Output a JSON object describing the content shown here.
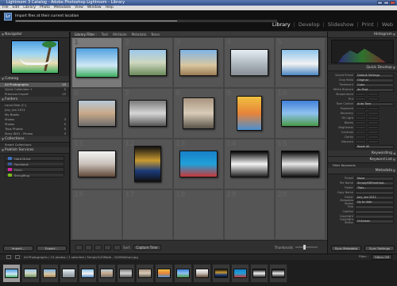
{
  "window": {
    "title": "Lightroom 3 Catalog - Adobe Photoshop Lightroom - Library",
    "menu": [
      "File",
      "Edit",
      "Library",
      "Photo",
      "Metadata",
      "View",
      "Window",
      "Help"
    ]
  },
  "identity": {
    "logo": "Lr",
    "import_message": "Import files at their current location",
    "progress": 0.62
  },
  "modules": [
    "Library",
    "Develop",
    "Slideshow",
    "Print",
    "Web"
  ],
  "left_panel": {
    "navigator": {
      "title": "Navigator",
      "zoom": [
        "FIT",
        "FILL",
        "1:1",
        "3:1"
      ]
    },
    "catalog": {
      "title": "Catalog",
      "items": [
        {
          "label": "All Photographs",
          "count": "15"
        },
        {
          "label": "Quick Collection +",
          "count": "0"
        },
        {
          "label": "Previous Import",
          "count": "15"
        }
      ]
    },
    "folders": {
      "title": "Folders",
      "items": [
        {
          "label": "Local Disk (C:)",
          "count": ""
        },
        {
          "label": "July, Jan 2011",
          "count": ""
        },
        {
          "label": "My Books",
          "count": ""
        },
        {
          "label": "Shows",
          "count": "3"
        },
        {
          "label": "Shows",
          "count": "5"
        },
        {
          "label": "Trips Photos",
          "count": "5"
        },
        {
          "label": "Sony WX1 - Picasa",
          "count": "3"
        }
      ]
    },
    "collections": {
      "title": "Collections",
      "items": [
        {
          "label": "Smart Collections",
          "count": ""
        }
      ]
    },
    "publish": {
      "title": "Publish Services",
      "items": [
        {
          "label": "Hard Drive",
          "color": "#3a6fb8"
        },
        {
          "label": "Facebook",
          "color": "#3b5998"
        },
        {
          "label": "Flickr",
          "color": "#d6249f"
        },
        {
          "label": "SmugMug",
          "color": "#7ab51d"
        }
      ]
    },
    "buttons": {
      "import": "Import...",
      "export": "Export..."
    }
  },
  "center": {
    "filter_bar": [
      "Library Filter :",
      "Text",
      "Attribute",
      "Metadata",
      "None"
    ],
    "toolbar": {
      "sort_label": "Sort:",
      "sort_value": "Capture Time",
      "thumbnails_label": "Thumbnails"
    },
    "grid": [
      {
        "n": "1",
        "selected": true,
        "w": 54,
        "h": 38,
        "bg": "linear-gradient(#4fa0e0, #cfe8f5 60%, #3fae60)"
      },
      {
        "n": "2",
        "selected": false,
        "w": 48,
        "h": 34,
        "bg": "linear-gradient(#9cc7ea, #cfd8c0 50%, #6a8a5a)"
      },
      {
        "n": "3",
        "selected": false,
        "w": 48,
        "h": 34,
        "bg": "linear-gradient(#7fb3e5, #d9c7a0 60%, #9a7b55)"
      },
      {
        "n": "4",
        "selected": false,
        "w": 48,
        "h": 34,
        "bg": "linear-gradient(#e5eef5, #a0a8b0 70%, #8a8f96)"
      },
      {
        "n": "5",
        "selected": false,
        "w": 48,
        "h": 34,
        "bg": "linear-gradient(#8ec5ec, #f2f2f2 55%, #4b86c2)"
      },
      {
        "n": "6",
        "selected": false,
        "w": 48,
        "h": 34,
        "bg": "linear-gradient(#b6c9d7, #c9a889 50%, #6d6d6d)"
      },
      {
        "n": "7",
        "selected": false,
        "w": 48,
        "h": 34,
        "bg": "linear-gradient(#7a7a7a, #d6d6d6 50%, #555)"
      },
      {
        "n": "8",
        "selected": false,
        "w": 40,
        "h": 40,
        "bg": "linear-gradient(#a89480, #d8ccb8 50%, #5a5248)"
      },
      {
        "n": "9",
        "selected": false,
        "w": 32,
        "h": 44,
        "bg": "linear-gradient(#f0c040, #e8843a 50%, #4a90d0)"
      },
      {
        "n": "10",
        "selected": false,
        "w": 48,
        "h": 34,
        "bg": "linear-gradient(#3f7fd8, #8fc2f0 50%, #4a9a4a)"
      },
      {
        "n": "11",
        "selected": false,
        "w": 48,
        "h": 34,
        "bg": "linear-gradient(#f4f4f4, #c8c0b8 50%, #604838)"
      },
      {
        "n": "12",
        "selected": false,
        "w": 34,
        "h": 46,
        "bg": "linear-gradient(#111, #c99a30 40%, #1a3a7a 70%, #111)"
      },
      {
        "n": "13",
        "selected": false,
        "w": 48,
        "h": 34,
        "bg": "linear-gradient(#1880c8, #20a0d8 50%, #c83838)"
      },
      {
        "n": "14",
        "selected": false,
        "w": 48,
        "h": 34,
        "bg": "linear-gradient(#000, #f4f4f4 50%, #222)"
      },
      {
        "n": "15",
        "selected": false,
        "w": 48,
        "h": 34,
        "bg": "linear-gradient(#000, #e8e8e8 50%, #111)"
      },
      {
        "n": "16",
        "selected": false,
        "w": 0,
        "h": 0,
        "bg": ""
      },
      {
        "n": "17",
        "selected": false,
        "w": 0,
        "h": 0,
        "bg": ""
      },
      {
        "n": "18",
        "selected": false,
        "w": 0,
        "h": 0,
        "bg": ""
      },
      {
        "n": "19",
        "selected": false,
        "w": 0,
        "h": 0,
        "bg": ""
      },
      {
        "n": "20",
        "selected": false,
        "w": 0,
        "h": 0,
        "bg": ""
      }
    ]
  },
  "right_panel": {
    "histogram": {
      "title": "Histogram"
    },
    "quick_develop": {
      "title": "Quick Develop",
      "rows": [
        {
          "label": "Saved Preset",
          "value": "Default Settings"
        },
        {
          "label": "Crop Ratio",
          "value": "Original"
        },
        {
          "label": "Treatment",
          "value": "Color"
        }
      ],
      "white_balance": {
        "label": "White Balance",
        "value": "As Shot"
      },
      "wb_rows": [
        "Temperature",
        "Tint"
      ],
      "tone_control": {
        "label": "Tone Control",
        "value": "Auto Tone"
      },
      "tone_rows": [
        "Exposure",
        "Recovery",
        "Fill Light",
        "Blacks",
        "Brightness",
        "Contrast"
      ],
      "presence_rows": [
        "Clarity",
        "Vibrance"
      ],
      "reset": "Reset All"
    },
    "keywording": {
      "title": "Keywording"
    },
    "keyword_list": {
      "title": "Keyword List",
      "filter": "Filter Keywords"
    },
    "metadata": {
      "title": "Metadata",
      "preset_label": "Preset",
      "preset_value": "None",
      "rows": [
        {
          "label": "File Name",
          "value": "SimplyHDRmethod..."
        },
        {
          "label": "Folder",
          "value": "Trips..."
        },
        {
          "label": "Copy Name",
          "value": ""
        },
        {
          "label": "Folder",
          "value": "July, Jan 2011"
        },
        {
          "label": "Metadata Status",
          "value": "Up to date"
        },
        {
          "label": "Title",
          "value": ""
        },
        {
          "label": "Caption",
          "value": ""
        },
        {
          "label": "Copyright",
          "value": ""
        },
        {
          "label": "Copyright Status",
          "value": "Unknown"
        }
      ]
    },
    "buttons": {
      "sync_metadata": "Sync Metadata",
      "sync_settings": "Sync Settings"
    }
  },
  "filmstrip": {
    "path": "All Photographs / 15 photos / 1 selected / Simply%20Moth...%20Method.jpg",
    "filter_label": "Filter :",
    "filter_value": "Filters Off",
    "thumbs": [
      "linear-gradient(#4fa0e0,#cfe8f5 60%,#3fae60)",
      "linear-gradient(#9cc7ea,#cfd8c0 50%,#6a8a5a)",
      "linear-gradient(#7fb3e5,#d9c7a0 60%,#9a7b55)",
      "linear-gradient(#e5eef5,#a0a8b0 70%,#8a8f96)",
      "linear-gradient(#8ec5ec,#f2f2f2 55%,#4b86c2)",
      "linear-gradient(#b6c9d7,#c9a889 50%,#6d6d6d)",
      "linear-gradient(#7a7a7a,#d6d6d6 50%,#555)",
      "linear-gradient(#a89480,#d8ccb8 50%,#5a5248)",
      "linear-gradient(#f0c040,#e8843a 50%,#4a90d0)",
      "linear-gradient(#3f7fd8,#8fc2f0 50%,#4a9a4a)",
      "linear-gradient(#f4f4f4,#c8c0b8 50%,#604838)",
      "linear-gradient(#111,#c99a30 40%,#1a3a7a 70%,#111)",
      "linear-gradient(#1880c8,#20a0d8 50%,#c83838)",
      "linear-gradient(#000,#f4f4f4 50%,#222)",
      "linear-gradient(#000,#e8e8e8 50%,#111)"
    ]
  }
}
